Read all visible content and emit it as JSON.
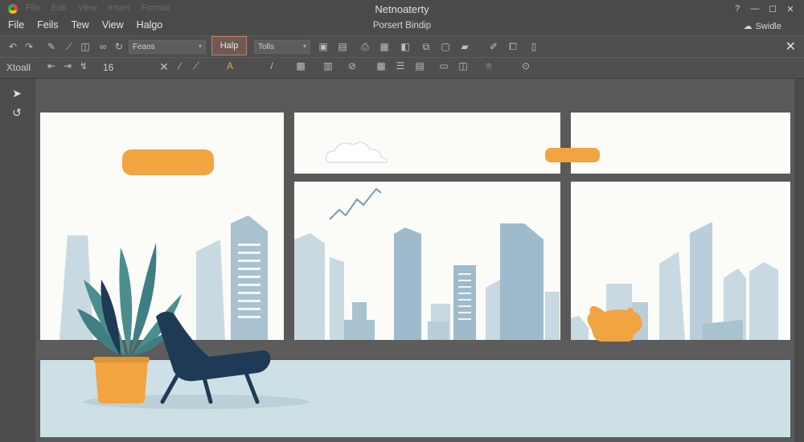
{
  "window": {
    "app_title": "Netnoaterty",
    "document_title": "Porsert Bindip",
    "faint_menu": [
      "File",
      "Edit",
      "View",
      "Insert",
      "Format"
    ],
    "menu": [
      "File",
      "Feils",
      "Tew",
      "View",
      "Halgo"
    ],
    "share_label": "Swidle"
  },
  "ribbon": {
    "font_select": "Feaos",
    "help_label": "Halp",
    "style_select": "Tolls",
    "row2_label": "Xtoall",
    "font_size": "16"
  },
  "icons": {
    "app": "app-icon",
    "select_tool": "cursor-icon",
    "lasso_tool": "lasso-icon",
    "close": "close-icon",
    "share": "cloud-icon",
    "chart_line": "trend-line-icon"
  },
  "colors": {
    "accent": "#F2A440",
    "sky": "#FBFBF8",
    "building_light": "#C9D9E1",
    "building_mid": "#9FBBCB",
    "floor": "#CDE0E6",
    "frame": "#595959",
    "chair": "#1E3A55",
    "leaf": "#4A8F8E"
  }
}
